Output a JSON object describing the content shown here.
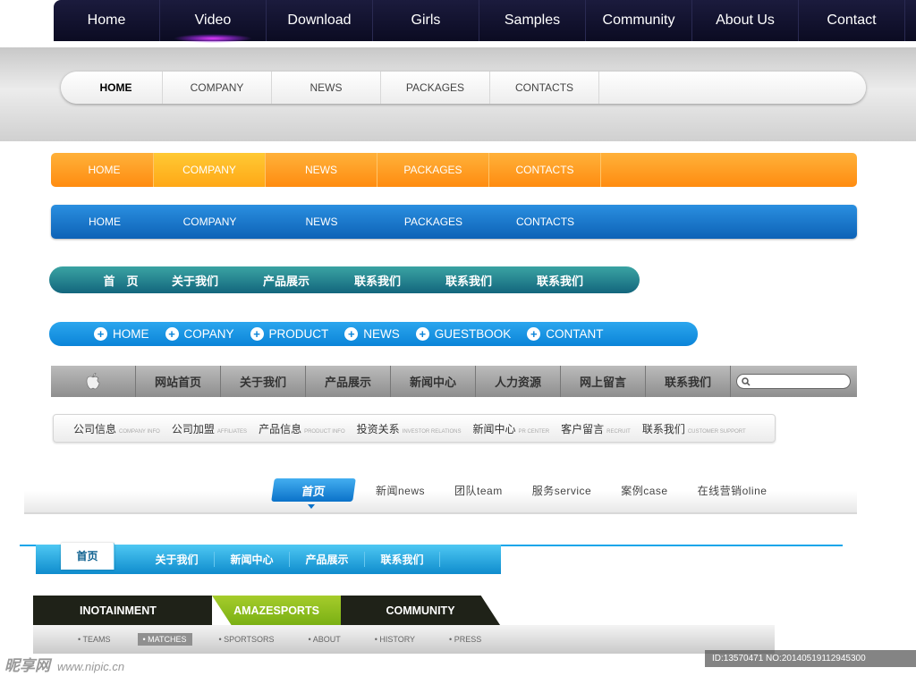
{
  "nav1": {
    "items": [
      "Home",
      "Video",
      "Download",
      "Girls",
      "Samples",
      "Community",
      "About Us",
      "Contact"
    ]
  },
  "nav2": {
    "items": [
      "HOME",
      "COMPANY",
      "NEWS",
      "PACKAGES",
      "CONTACTS"
    ]
  },
  "nav3": {
    "items": [
      "HOME",
      "COMPANY",
      "NEWS",
      "PACKAGES",
      "CONTACTS"
    ]
  },
  "nav4": {
    "items": [
      "HOME",
      "COMPANY",
      "NEWS",
      "PACKAGES",
      "CONTACTS"
    ]
  },
  "nav5": {
    "items": [
      "首　页",
      "关于我们",
      "产品展示",
      "联系我们",
      "联系我们",
      "联系我们"
    ]
  },
  "nav6": {
    "items": [
      "HOME",
      "COPANY",
      "PRODUCT",
      "NEWS",
      "GUESTBOOK",
      "CONTANT"
    ]
  },
  "nav7": {
    "items": [
      "网站首页",
      "关于我们",
      "产品展示",
      "新闻中心",
      "人力资源",
      "网上留言",
      "联系我们"
    ]
  },
  "nav8": {
    "items": [
      {
        "cn": "公司信息",
        "en": "company info"
      },
      {
        "cn": "公司加盟",
        "en": "affiliates"
      },
      {
        "cn": "产品信息",
        "en": "product info"
      },
      {
        "cn": "投资关系",
        "en": "investor relations"
      },
      {
        "cn": "新闻中心",
        "en": "pr center"
      },
      {
        "cn": "客户留言",
        "en": "recruit"
      },
      {
        "cn": "联系我们",
        "en": "customer support"
      }
    ]
  },
  "nav9": {
    "active": "首页",
    "items": [
      "新闻news",
      "团队team",
      "服务service",
      "案例case",
      "在线营销oline"
    ]
  },
  "nav10": {
    "items": [
      "首页",
      "关于我们",
      "新闻中心",
      "产品展示",
      "联系我们"
    ]
  },
  "nav11": {
    "tabs": [
      "INOTAINMENT",
      "AMAZESPORTS",
      "COMMUNITY"
    ],
    "sub": [
      "TEAMS",
      "MATCHES",
      "SPORTSORS",
      "ABOUT",
      "HISTORY",
      "PRESS"
    ]
  },
  "watermark": {
    "brand": "昵享网",
    "url": "www.nipic.cn",
    "id": "ID:13570471 NO:20140519112945300"
  }
}
